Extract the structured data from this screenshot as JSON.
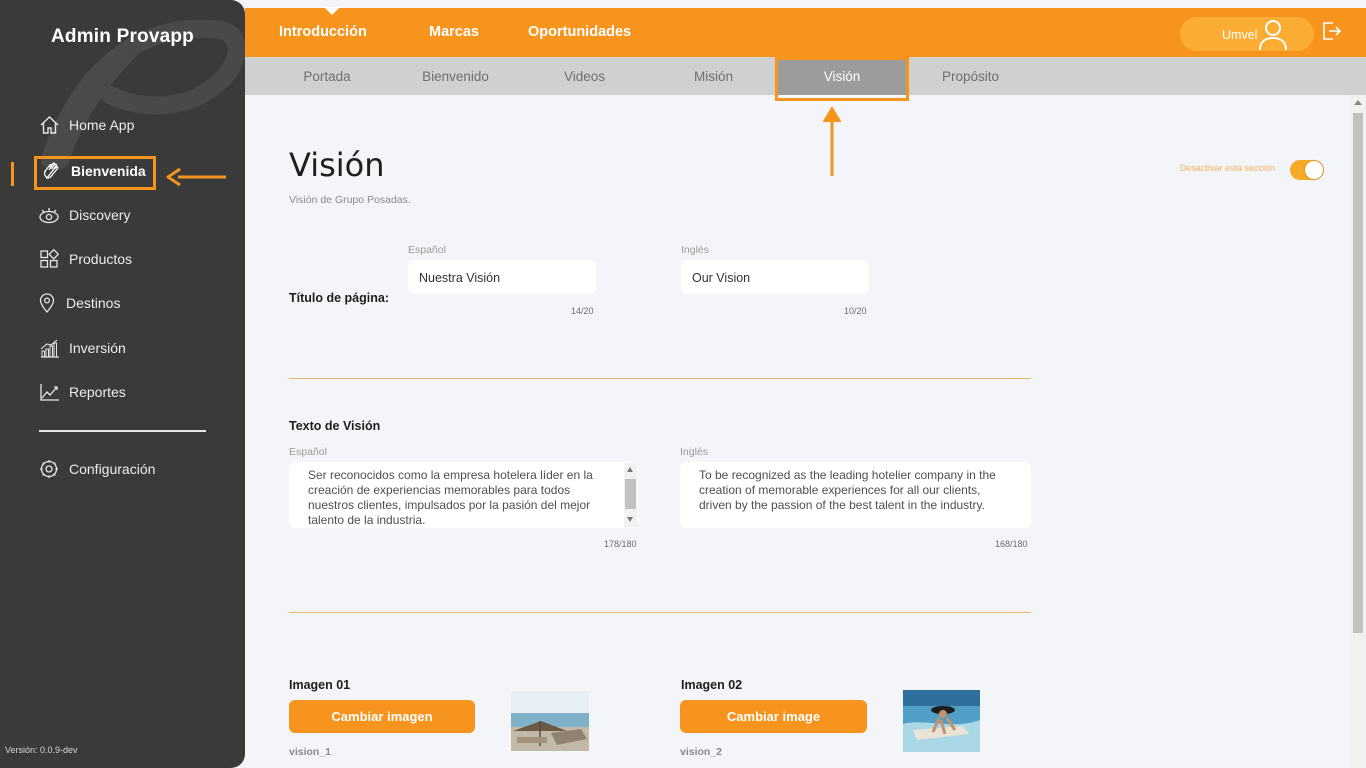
{
  "sidebar": {
    "brand": "Admin Provapp",
    "items": [
      {
        "label": "Home App",
        "icon": "home-icon"
      },
      {
        "label": "Bienvenida",
        "icon": "waving-hand-icon",
        "active": true
      },
      {
        "label": "Discovery",
        "icon": "eye-icon"
      },
      {
        "label": "Productos",
        "icon": "grid-icon"
      },
      {
        "label": "Destinos",
        "icon": "location-pin-icon"
      },
      {
        "label": "Inversión",
        "icon": "bar-chart-icon"
      },
      {
        "label": "Reportes",
        "icon": "line-chart-icon"
      }
    ],
    "settings": {
      "label": "Configuración",
      "icon": "gear-icon"
    },
    "version": "Versión: 0.0.9-dev"
  },
  "topbar": {
    "tabs": [
      "Introducción",
      "Marcas",
      "Oportunidades"
    ],
    "user": "Umvel"
  },
  "subtabs": {
    "items": [
      "Portada",
      "Bienvenido",
      "Videos",
      "Misión",
      "Visión",
      "Propósito"
    ],
    "active": "Visión"
  },
  "page": {
    "title": "Visión",
    "subtitle": "Visión de Grupo Posadas.",
    "toggle_label": "Desactivar esta sección",
    "toggle_on": true
  },
  "title_section": {
    "label": "Título de página:",
    "spanish_caption": "Español",
    "english_caption": "Inglés",
    "spanish_value": "Nuestra Visión",
    "english_value": "Our Vision",
    "spanish_count": "14/20",
    "english_count": "10/20"
  },
  "text_section": {
    "label": "Texto de Visión",
    "spanish_caption": "Español",
    "english_caption": "Inglés",
    "spanish_value": "Ser reconocidos como la empresa hotelera líder en la creación de experiencias memorables para todos nuestros clientes, impulsados por la pasión del mejor talento de la industria.",
    "english_value": "To be recognized as the leading hotelier company in the creation of memorable experiences for all our clients, driven by the passion of the best talent in the industry.",
    "spanish_count": "178/180",
    "english_count": "168/180"
  },
  "images": [
    {
      "label": "Imagen 01",
      "button": "Cambiar imagen",
      "name": "vision_1"
    },
    {
      "label": "Imagen 02",
      "button": "Cambiar image",
      "name": "vision_2"
    }
  ],
  "colors": {
    "accent": "#f7941d",
    "sidebar": "#3a3a3a",
    "subbar": "#d0d0d0",
    "active_subtab": "#9c9c9c"
  }
}
